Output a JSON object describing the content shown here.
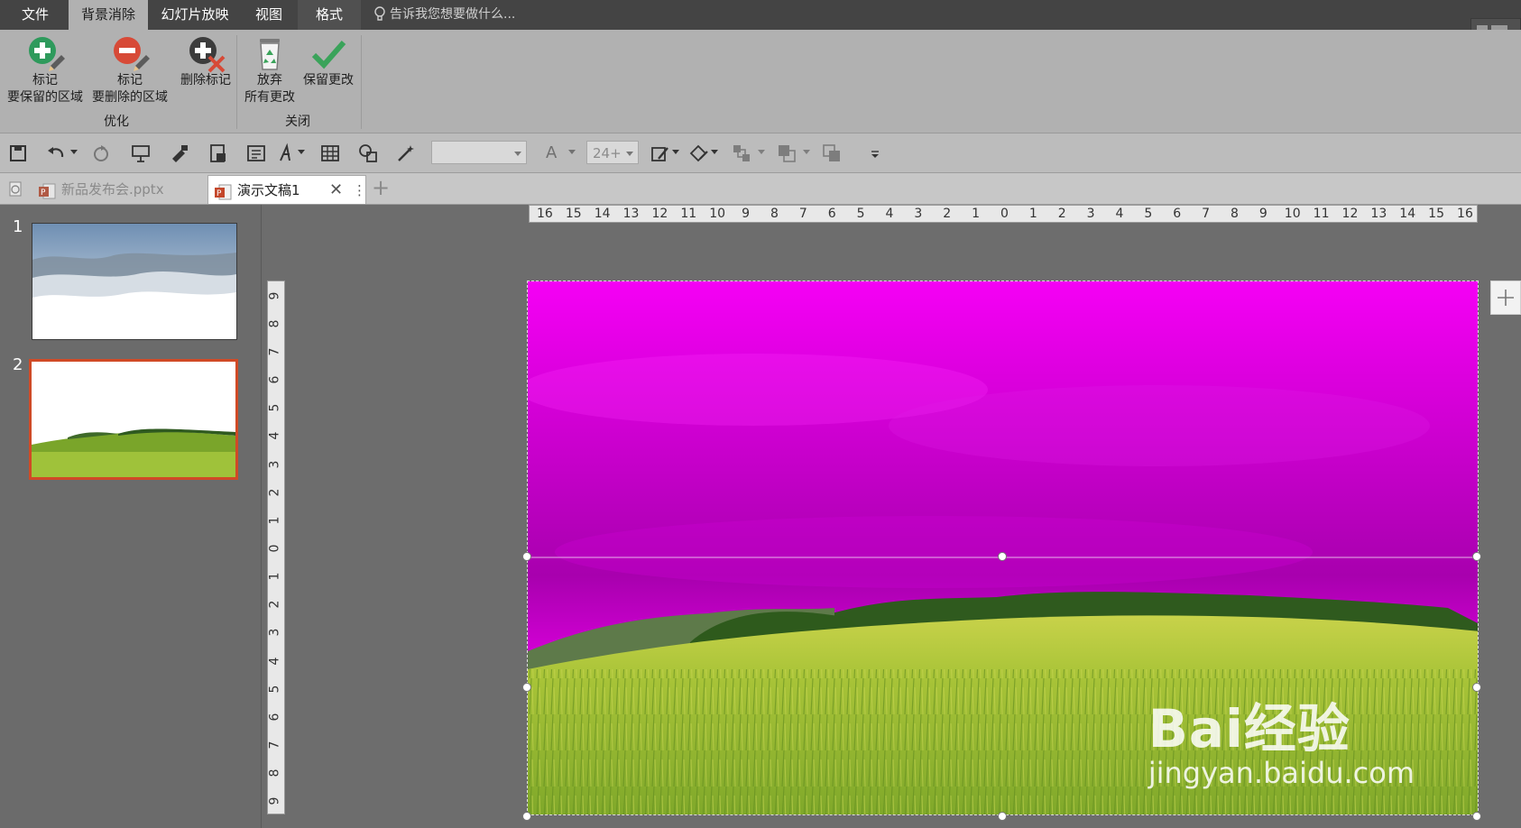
{
  "menu": {
    "tabs": [
      {
        "label": "文件"
      },
      {
        "label": "背景消除"
      },
      {
        "label": "幻灯片放映"
      },
      {
        "label": "视图"
      },
      {
        "label": "格式"
      }
    ],
    "tell_me_placeholder": "告诉我您想要做什么..."
  },
  "ribbon": {
    "mark_keep": {
      "line1": "标记",
      "line2": "要保留的区域"
    },
    "mark_remove": {
      "line1": "标记",
      "line2": "要删除的区域"
    },
    "delete_mark": {
      "line1": "删除标记"
    },
    "discard": {
      "line1": "放弃",
      "line2": "所有更改"
    },
    "keep_changes": {
      "line1": "保留更改"
    },
    "group_refine": "优化",
    "group_close": "关闭"
  },
  "toolbar": {
    "font_size": "24+",
    "font_letter": "A"
  },
  "doc_tabs": [
    {
      "label": "新品发布会.pptx"
    },
    {
      "label": "演示文稿1"
    }
  ],
  "slides": {
    "numbers": [
      "1",
      "2"
    ],
    "selected": "2"
  },
  "rulers": {
    "horizontal": [
      "16",
      "15",
      "14",
      "13",
      "12",
      "11",
      "10",
      "9",
      "8",
      "7",
      "6",
      "5",
      "4",
      "3",
      "2",
      "1",
      "0",
      "1",
      "2",
      "3",
      "4",
      "5",
      "6",
      "7",
      "8",
      "9",
      "10",
      "11",
      "12",
      "13",
      "14",
      "15",
      "16"
    ],
    "vertical": [
      "9",
      "8",
      "7",
      "6",
      "5",
      "4",
      "3",
      "2",
      "1",
      "0",
      "1",
      "2",
      "3",
      "4",
      "5",
      "6",
      "7",
      "8",
      "9"
    ]
  },
  "watermark": {
    "main": "Bai经验",
    "sub": "jingyan.baidu.com"
  },
  "colors": {
    "menubar": "#444444",
    "ribbon": "#b1b1b1",
    "removal_mask": "#ee00ee",
    "selected_slide_border": "#d04a26"
  },
  "icons": {
    "mark_keep": "pencil-plus-icon",
    "mark_remove": "pencil-minus-icon",
    "delete_mark": "delete-mark-icon",
    "discard": "recycle-bin-icon",
    "keep": "checkmark-icon"
  }
}
